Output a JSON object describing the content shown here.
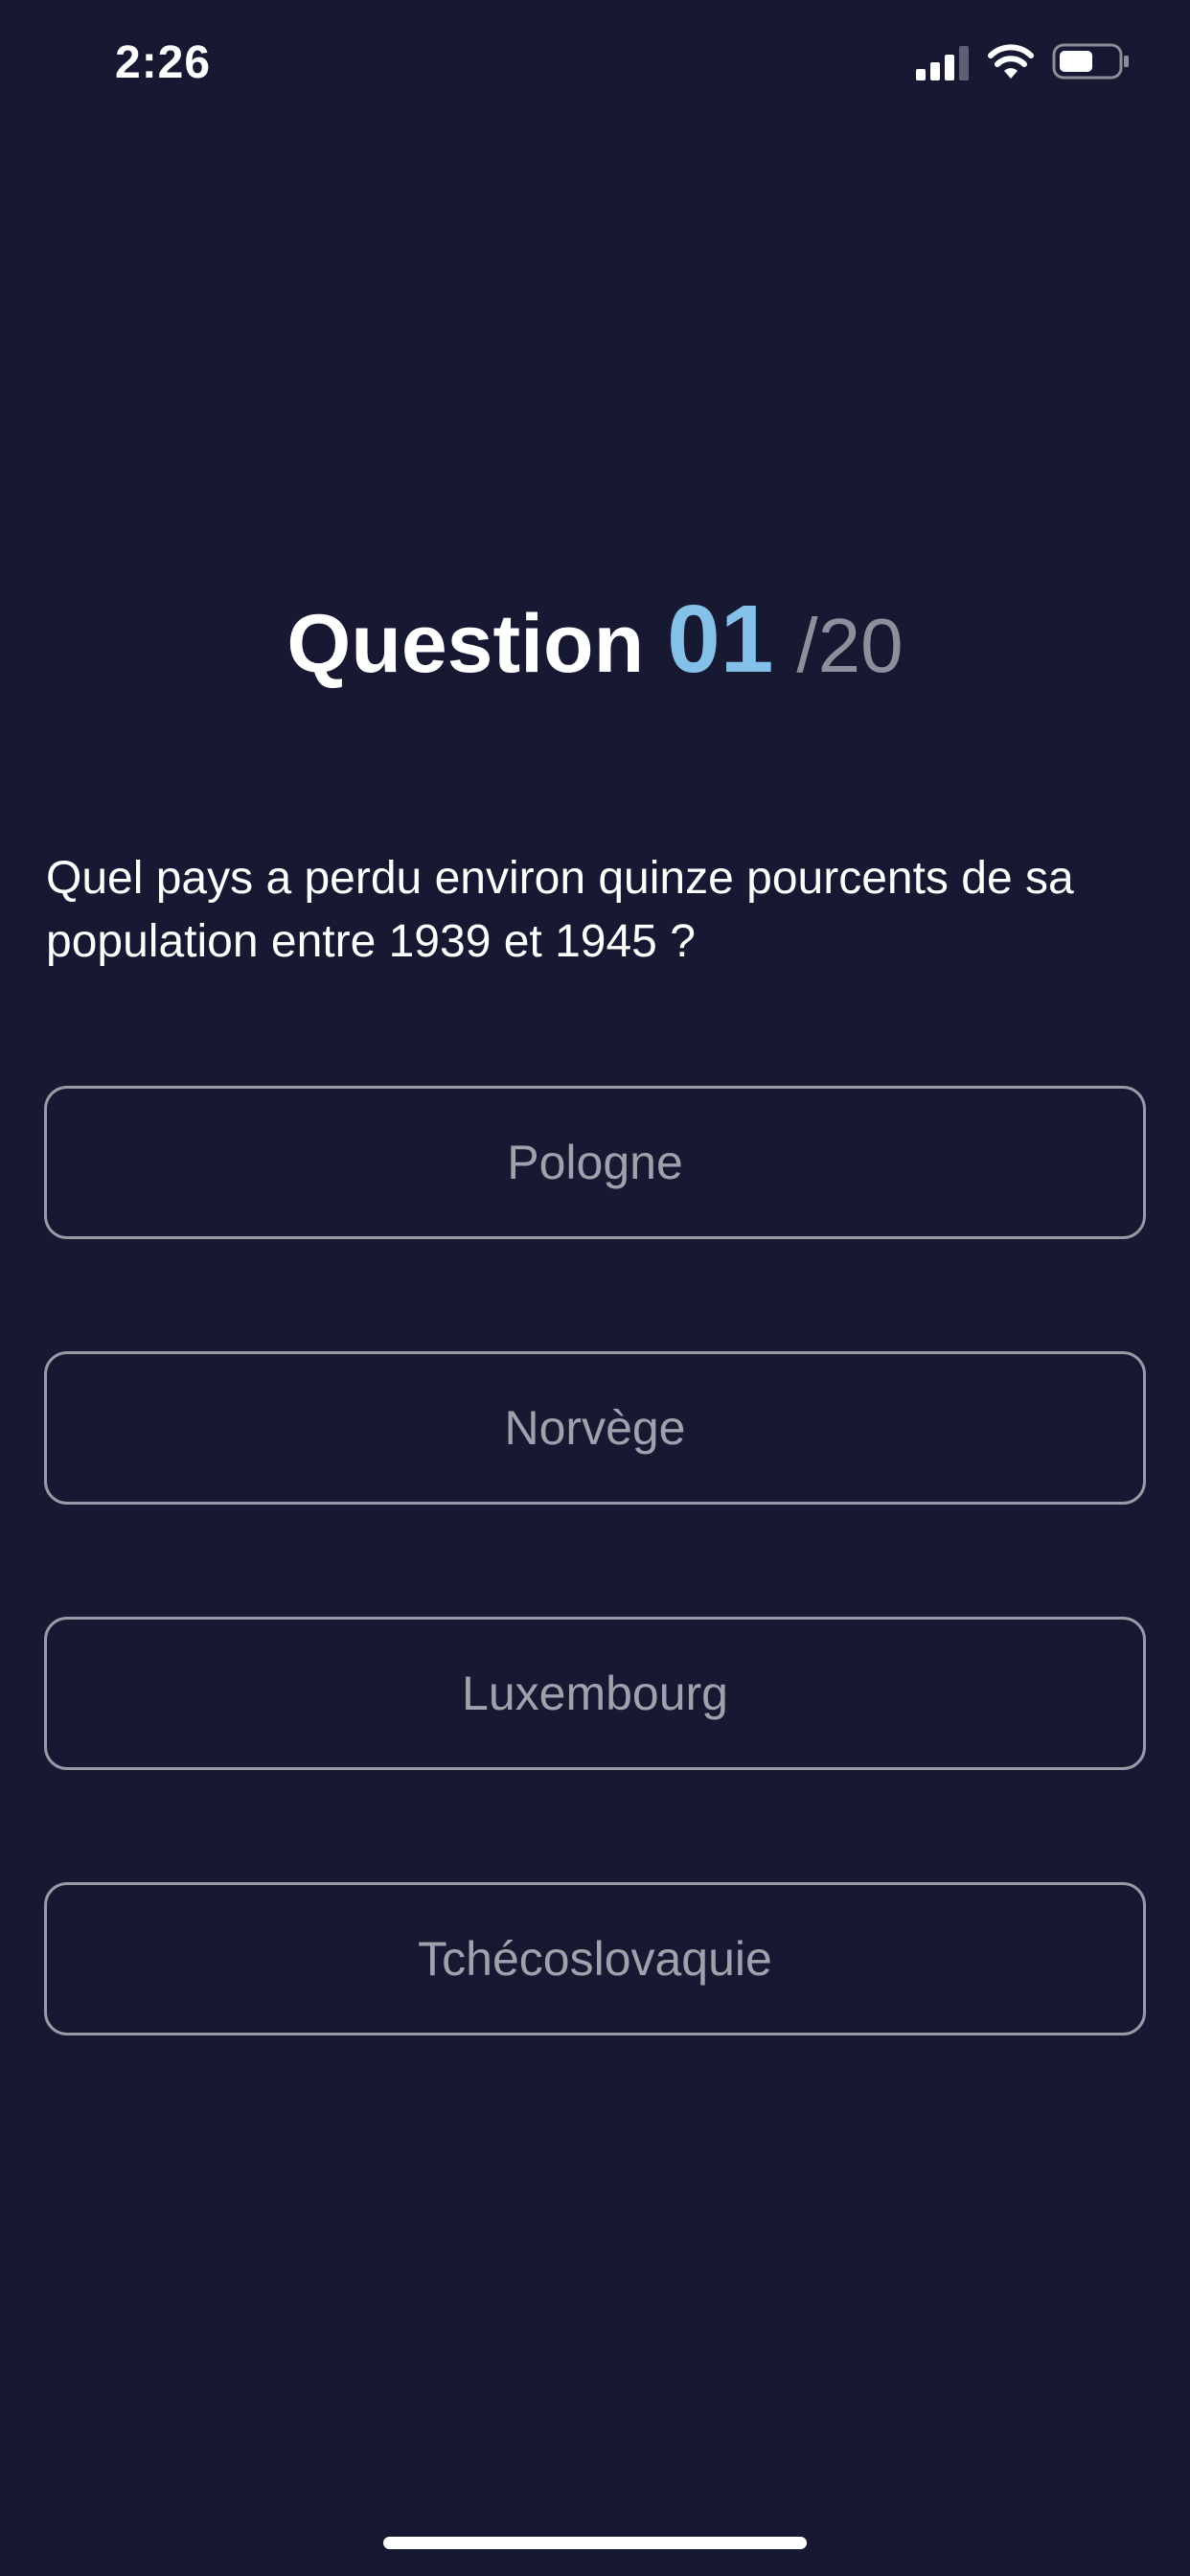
{
  "status_bar": {
    "time": "2:26"
  },
  "question": {
    "label": "Question",
    "number": "01",
    "total": "/20",
    "text": "Quel pays a perdu environ quinze pourcents de sa population entre 1939 et 1945 ?"
  },
  "answers": [
    {
      "label": "Pologne"
    },
    {
      "label": "Norvège"
    },
    {
      "label": "Luxembourg"
    },
    {
      "label": "Tchécoslovaquie"
    }
  ],
  "colors": {
    "background": "#171932",
    "accent": "#84c0e8",
    "muted": "#8d8f9c",
    "answer_border": "#9a9aa6"
  }
}
